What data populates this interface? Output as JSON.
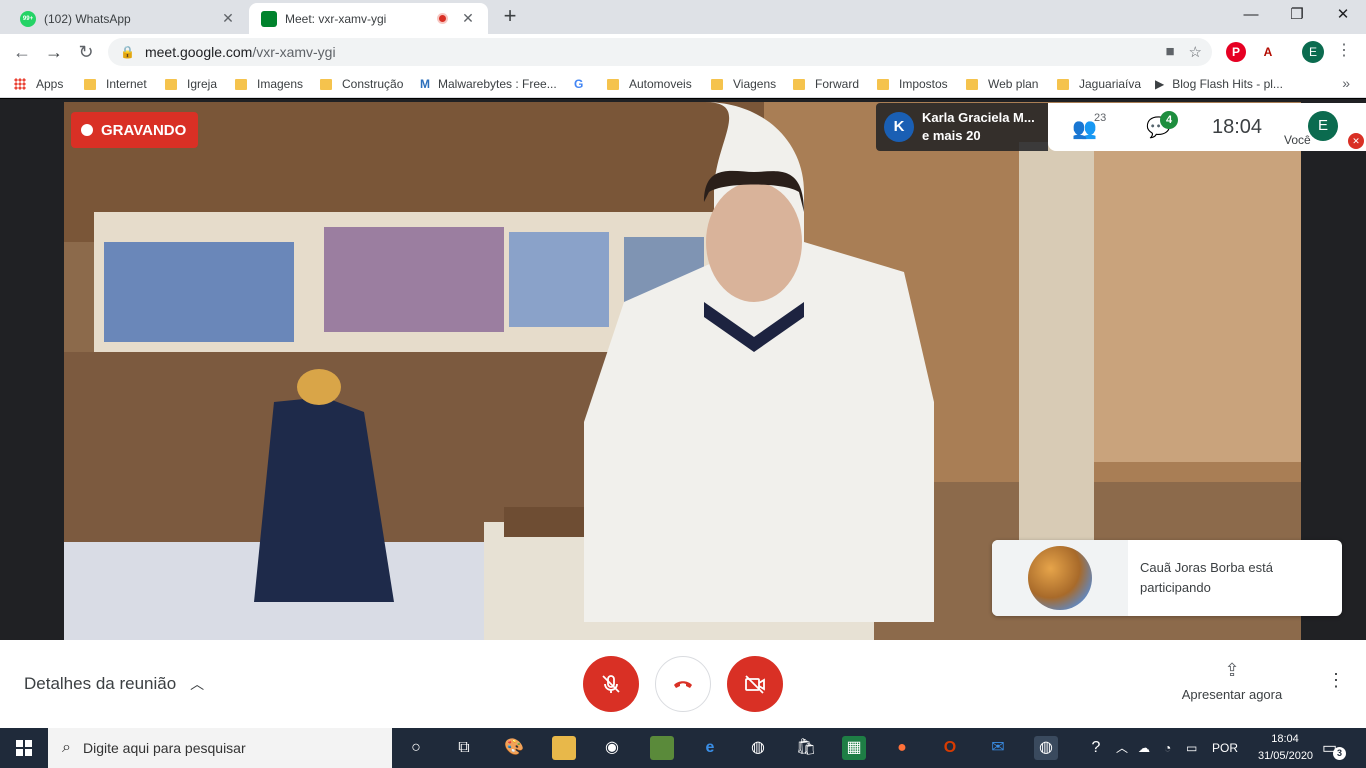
{
  "browser": {
    "tabs": [
      {
        "title": "(102) WhatsApp",
        "badge": "99+",
        "active": false
      },
      {
        "title": "Meet: vxr-xamv-ygi",
        "active": true
      }
    ],
    "new_tab": "+",
    "window_controls": {
      "minimize": "—",
      "restore": "❐",
      "close": "✕"
    },
    "url_domain": "meet.google.com",
    "url_path": "/vxr-xamv-ygi",
    "profile_initial": "E",
    "bookmarks": [
      {
        "label": "Apps",
        "icon": "apps-grid-icon"
      },
      {
        "label": "Internet",
        "icon": "folder-icon"
      },
      {
        "label": "Igreja",
        "icon": "folder-icon"
      },
      {
        "label": "Imagens",
        "icon": "folder-icon"
      },
      {
        "label": "Construção",
        "icon": "folder-icon"
      },
      {
        "label": "Malwarebytes : Free...",
        "icon": "malwarebytes-icon"
      },
      {
        "label": "",
        "icon": "google-icon"
      },
      {
        "label": "Automoveis",
        "icon": "folder-icon"
      },
      {
        "label": "Viagens",
        "icon": "folder-icon"
      },
      {
        "label": "Forward",
        "icon": "folder-icon"
      },
      {
        "label": "Impostos",
        "icon": "folder-icon"
      },
      {
        "label": "Web plan",
        "icon": "folder-icon"
      },
      {
        "label": "Jaguariaíva",
        "icon": "folder-icon"
      },
      {
        "label": "Blog Flash Hits - pl...",
        "icon": "play-icon"
      }
    ],
    "bookmarks_more": "»"
  },
  "meet": {
    "recording_label": "GRAVANDO",
    "presenter_initial": "K",
    "presenter_name": "Karla Graciela M...",
    "presenter_others": "e mais 20",
    "participants_count": "23",
    "chat_unread": "4",
    "time": "18:04",
    "self_initial": "E",
    "self_label": "Você",
    "toast_message": "Cauã Joras Borba está participando",
    "meeting_details": "Detalhes da reunião",
    "present_now": "Apresentar agora"
  },
  "taskbar": {
    "search_placeholder": "Digite aqui para pesquisar",
    "language": "POR",
    "clock_time": "18:04",
    "clock_date": "31/05/2020",
    "notifications": "3"
  },
  "colors": {
    "meet_red": "#d93025",
    "meet_green": "#1e8e3e",
    "tab_strip": "#dee1e6",
    "taskbar": "#1f2a3a"
  }
}
